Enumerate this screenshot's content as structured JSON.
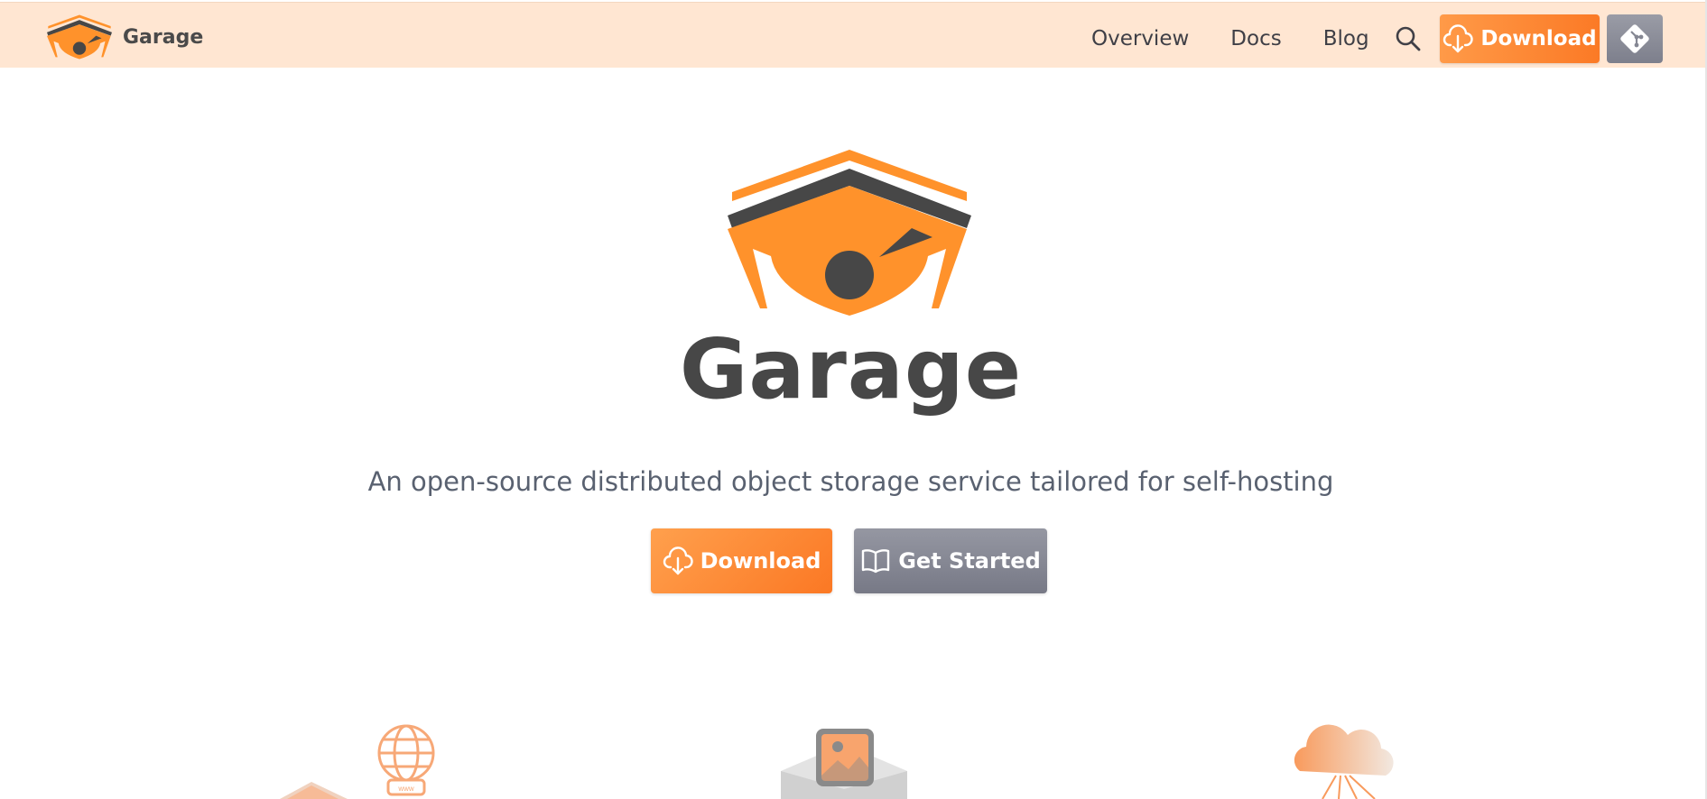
{
  "navbar": {
    "brand": {
      "name": "Garage",
      "logo_icon": "garage-logo-icon"
    },
    "links": [
      {
        "label": "Overview"
      },
      {
        "label": "Docs"
      },
      {
        "label": "Blog"
      }
    ],
    "search_icon": "search-icon",
    "download_button": {
      "label": "Download",
      "icon": "cloud-download-icon"
    },
    "git_button": {
      "icon": "git-icon"
    }
  },
  "hero": {
    "title": "Garage",
    "subtitle": "An open-source distributed object storage service tailored for self-hosting",
    "download_button": {
      "label": "Download",
      "icon": "cloud-download-icon"
    },
    "get_started_button": {
      "label": "Get Started",
      "icon": "open-book-icon"
    }
  },
  "features_preview": [
    {
      "icon": "web-hosting-illustration"
    },
    {
      "icon": "media-storage-illustration"
    },
    {
      "icon": "cloud-network-illustration"
    }
  ],
  "colors": {
    "navbar_bg": "#ffe6d2",
    "accent_orange": "#fb7a26",
    "logo_orange": "#ff922b",
    "logo_dark": "#474747",
    "secondary_gray": "#7d7f8c",
    "subtitle_text": "#596170"
  }
}
